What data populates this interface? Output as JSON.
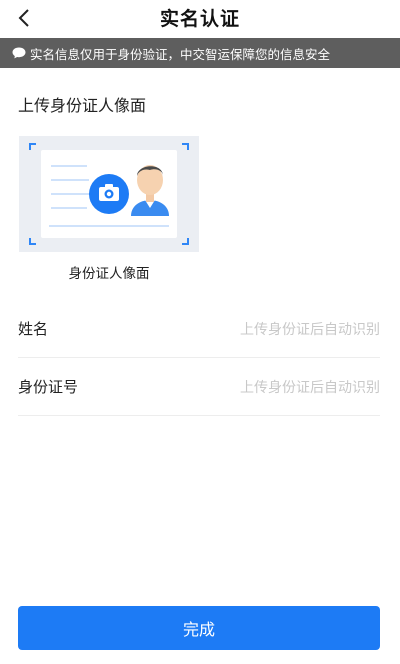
{
  "header": {
    "title": "实名认证",
    "back_icon": "chevron-left-icon"
  },
  "notice": {
    "icon": "chat-bubble-icon",
    "text": "实名信息仅用于身份验证，中交智运保障您的信息安全"
  },
  "upload": {
    "section_title": "上传身份证人像面",
    "card_label": "身份证人像面",
    "icons": [
      "camera-icon",
      "avatar-illustration"
    ],
    "accent_color": "#1d7bf5"
  },
  "form": {
    "fields": [
      {
        "label": "姓名",
        "placeholder": "上传身份证后自动识别"
      },
      {
        "label": "身份证号",
        "placeholder": "上传身份证后自动识别"
      }
    ]
  },
  "actions": {
    "submit_label": "完成",
    "submit_color": "#1d7bf5"
  }
}
